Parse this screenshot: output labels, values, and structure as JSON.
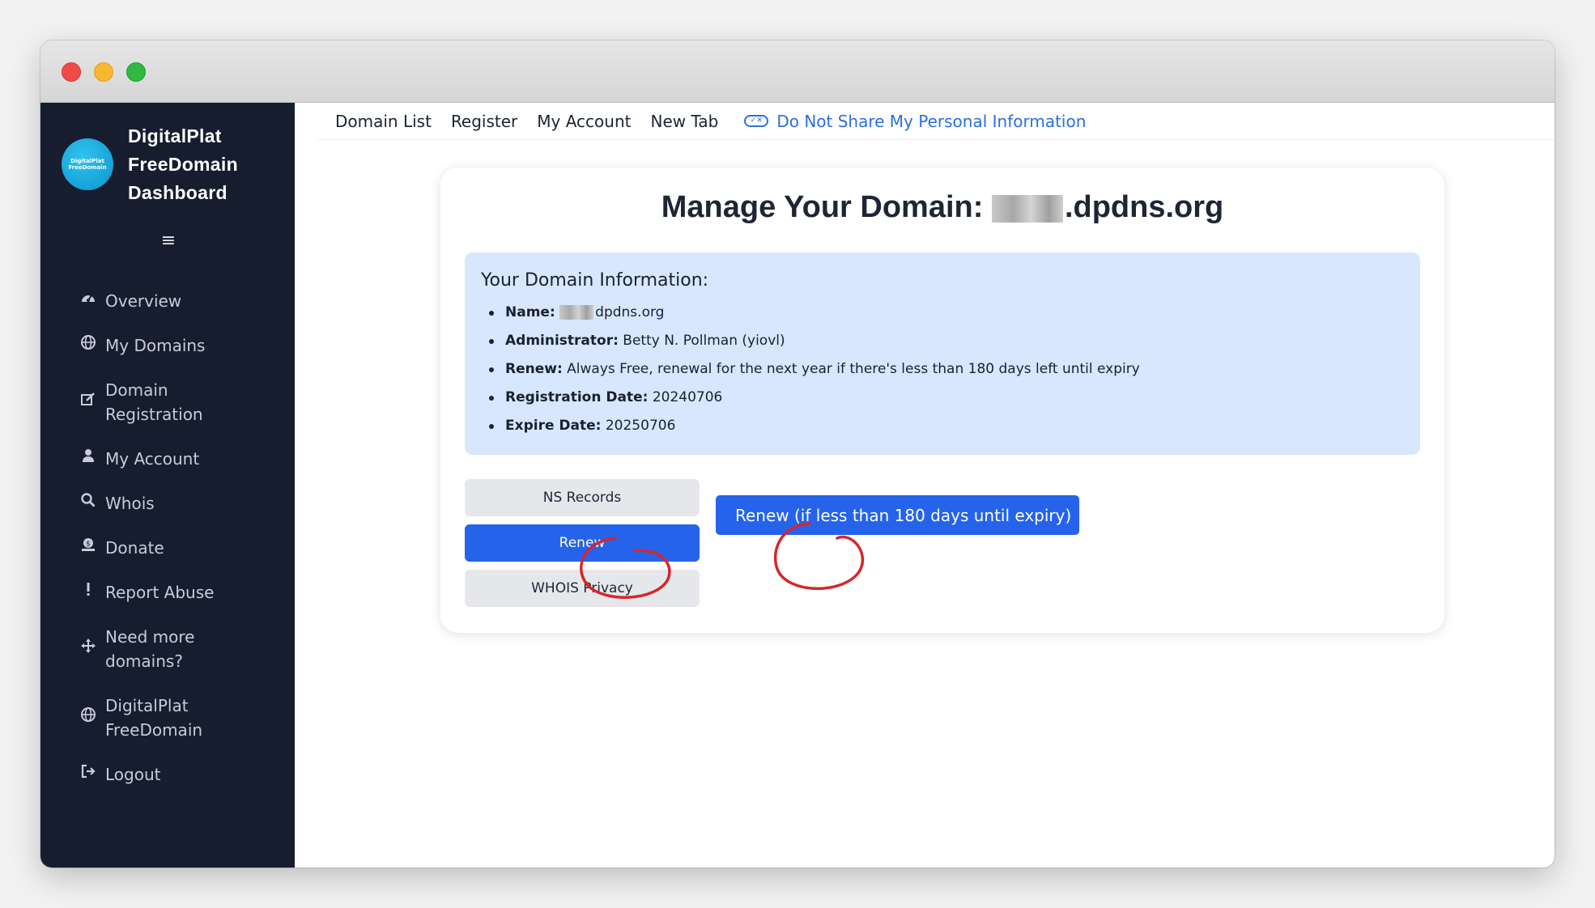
{
  "window": {
    "controls": [
      "close",
      "minimize",
      "zoom"
    ]
  },
  "sidebar": {
    "logo_text_1": "DigitalPlat",
    "logo_text_2": "FreeDomain",
    "brand_line_1": "DigitalPlat",
    "brand_line_2": "FreeDomain",
    "brand_line_3": "Dashboard",
    "menu_icon": "hamburger-icon",
    "items": [
      {
        "label": "Overview",
        "icon": "dashboard-gauge-icon"
      },
      {
        "label": "My Domains",
        "icon": "globe-icon"
      },
      {
        "label": "Domain Registration",
        "icon": "edit-icon"
      },
      {
        "label": "My Account",
        "icon": "user-icon"
      },
      {
        "label": "Whois",
        "icon": "search-icon"
      },
      {
        "label": "Donate",
        "icon": "donate-icon"
      },
      {
        "label": "Report Abuse",
        "icon": "exclamation-icon"
      },
      {
        "label": "Need more domains?",
        "icon": "move-arrows-icon"
      },
      {
        "label": "DigitalPlat FreeDomain",
        "icon": "globe-icon"
      },
      {
        "label": "Logout",
        "icon": "logout-icon"
      }
    ]
  },
  "topnav": {
    "links": [
      "Domain List",
      "Register",
      "My Account",
      "New Tab"
    ],
    "privacy_label": "Do Not Share My Personal Information",
    "privacy_icon": "privacy-toggle-icon",
    "accent_color": "#2a6fdb"
  },
  "card": {
    "title_prefix": "Manage Your Domain:",
    "title_domain_suffix": ".dpdns.org",
    "info_heading": "Your Domain Information:",
    "info": {
      "name_label": "Name:",
      "name_value": "dpdns.org",
      "admin_label": "Administrator:",
      "admin_value": "Betty N. Pollman (yiovl)",
      "renew_label": "Renew:",
      "renew_value": "Always Free, renewal for the next year if there's less than 180 days left until expiry",
      "reg_label": "Registration Date:",
      "reg_value": "20240706",
      "expire_label": "Expire Date:",
      "expire_value": "20250706"
    },
    "buttons": {
      "ns_records": "NS Records",
      "renew": "Renew",
      "whois_privacy": "WHOIS Privacy",
      "renew_full": "Renew (if less than 180 days until expiry)"
    }
  },
  "colors": {
    "sidebar_bg": "#161d2e",
    "primary_button": "#2563eb",
    "info_box_bg": "#d8e7fd",
    "annotation_red": "#d7262b"
  }
}
